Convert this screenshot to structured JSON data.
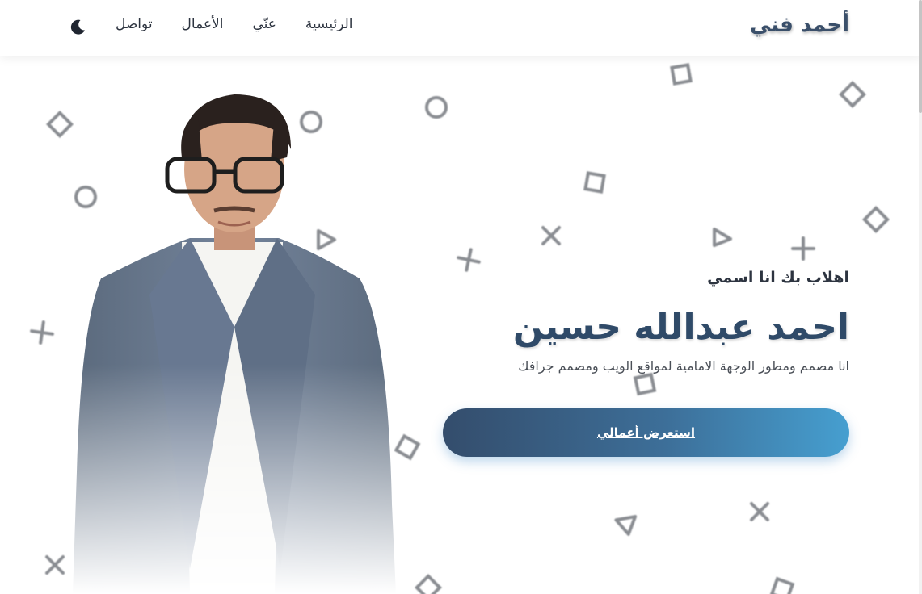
{
  "nav": {
    "brand": "أحمد فني",
    "links": [
      "الرئيسية",
      "عنّي",
      "الأعمال",
      "تواصل"
    ],
    "theme_toggle_icon": "moon-icon"
  },
  "hero": {
    "intro": "اهلاب بك انا اسمي",
    "name": "احمد عبدالله حسين",
    "description": "انا مصمم ومطور الوجهة الامامية لمواقع الويب ومصمم جرافك",
    "cta_label": "استعرض أعمالي",
    "portrait_icon": "portrait-photo-icon",
    "decoration_icons": [
      "square-shape-icon",
      "circle-shape-icon",
      "triangle-shape-icon",
      "cross-shape-icon"
    ]
  },
  "colors": {
    "brand": "#3a4f6a",
    "accent_start": "#344d6c",
    "accent_end": "#469fd0",
    "text": "#2d3440"
  }
}
